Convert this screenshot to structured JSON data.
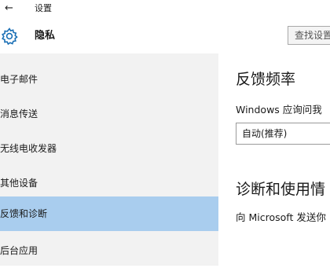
{
  "titlebar": {
    "back_glyph": "←",
    "title": "设置"
  },
  "header": {
    "icon": "gear-icon",
    "title": "隐私",
    "search_text": "查找设置"
  },
  "sidebar": {
    "items": [
      {
        "label": "电子邮件",
        "selected": false
      },
      {
        "label": "消息传送",
        "selected": false
      },
      {
        "label": "无线电收发器",
        "selected": false
      },
      {
        "label": "其他设备",
        "selected": false
      },
      {
        "label": "反馈和诊断",
        "selected": true
      },
      {
        "label": "后台应用",
        "selected": false
      }
    ]
  },
  "main": {
    "feedback_heading": "反馈频率",
    "feedback_question": "Windows 应询问我",
    "frequency_value": "自动(推荐)",
    "diagnostics_heading": "诊断和使用情",
    "diagnostics_text": "向 Microsoft 发送你"
  },
  "colors": {
    "sidebar_bg": "#f2f2f2",
    "selected_bg": "#a9cdee",
    "main_bg": "#ffffff"
  }
}
